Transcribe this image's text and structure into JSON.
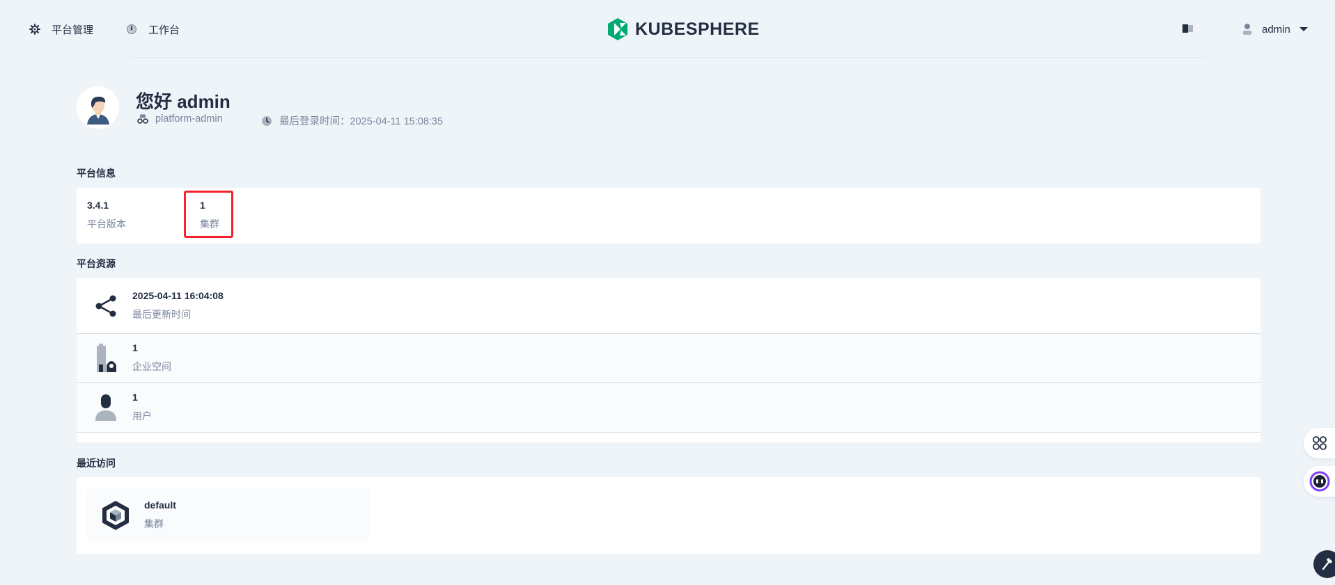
{
  "header": {
    "nav": [
      {
        "label": "平台管理",
        "icon": "gear-icon"
      },
      {
        "label": "工作台",
        "icon": "dashboard-icon"
      }
    ],
    "logo_text": "KUBESPHERE",
    "user": {
      "name": "admin"
    }
  },
  "profile": {
    "greeting": "您好 admin",
    "role": "platform-admin",
    "last_login": "最后登录时间：2025-04-11 15:08:35"
  },
  "platform_info": {
    "title": "平台信息",
    "items": [
      {
        "value": "3.4.1",
        "label": "平台版本"
      },
      {
        "value": "1",
        "label": "集群"
      }
    ]
  },
  "platform_resources": {
    "title": "平台资源",
    "rows": [
      {
        "value": "2025-04-11 16:04:08",
        "label": "最后更新时间",
        "icon": "share-nodes-icon"
      },
      {
        "value": "1",
        "label": "企业空间",
        "icon": "workspace-building-icon"
      },
      {
        "value": "1",
        "label": "用户",
        "icon": "user-icon"
      }
    ]
  },
  "recent": {
    "title": "最近访问",
    "items": [
      {
        "name": "default",
        "type": "集群",
        "icon": "cluster-cube-icon"
      }
    ]
  },
  "colors": {
    "page_bg": "#eff4f9",
    "brand_green": "#00aa72",
    "text_dark": "#242e42",
    "text_muted": "#79879c",
    "highlight_red": "#f5222d"
  }
}
